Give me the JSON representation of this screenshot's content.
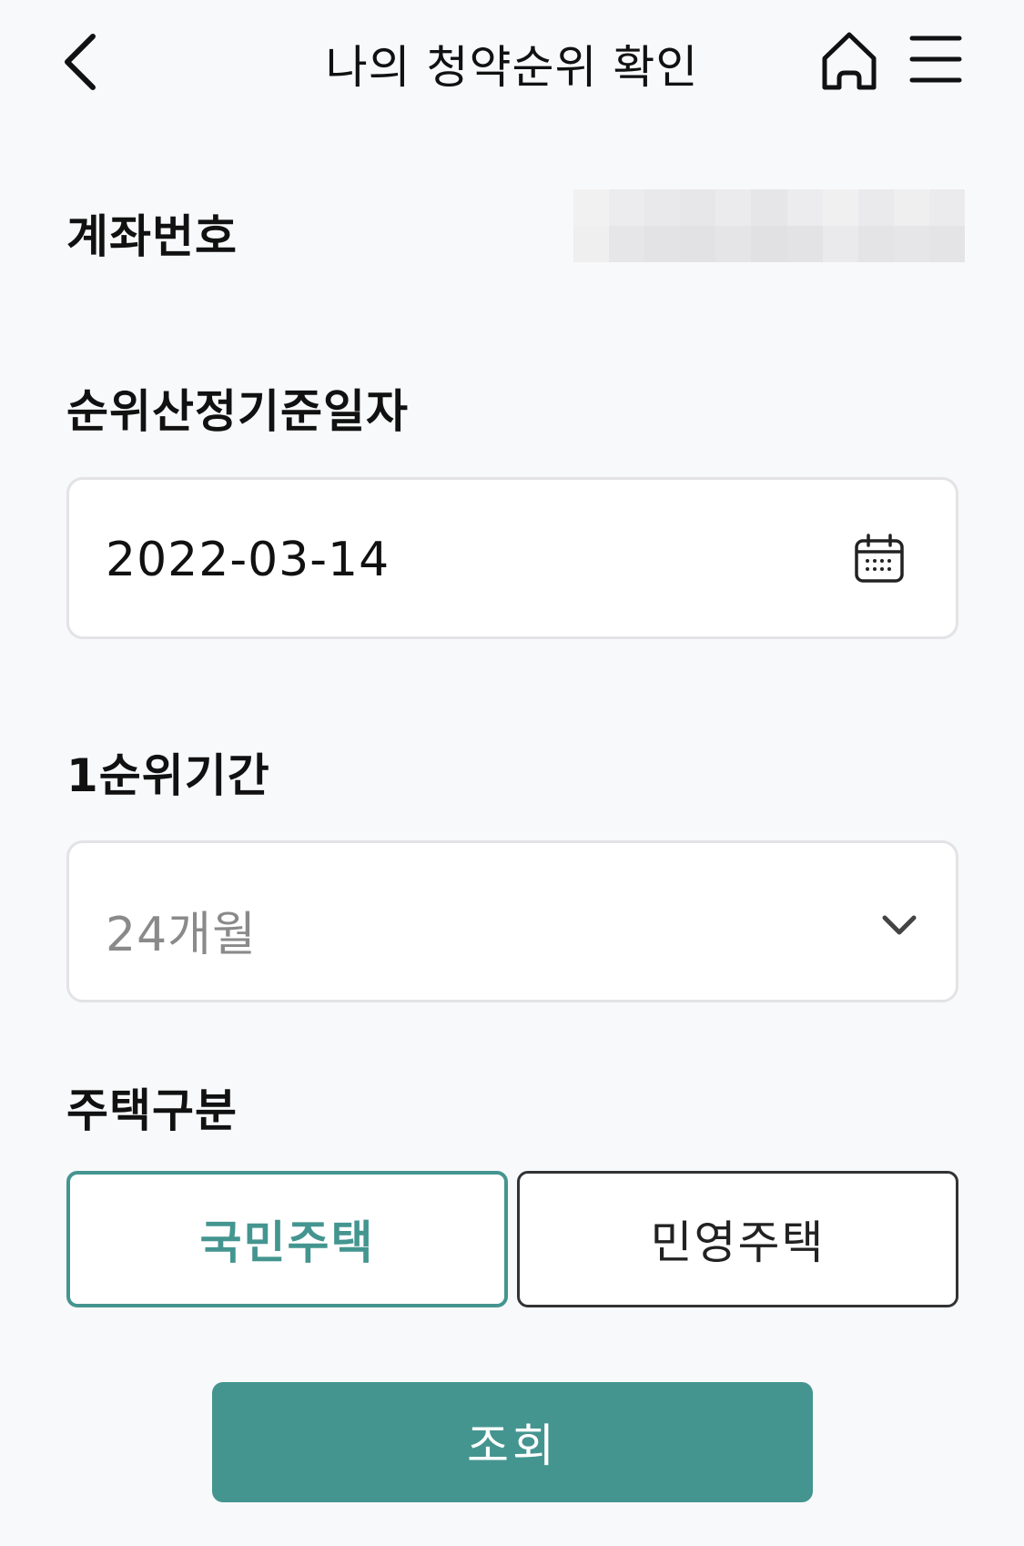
{
  "header": {
    "title": "나의 청약순위 확인",
    "back_icon": "chevron-left-icon",
    "home_icon": "home-icon",
    "menu_icon": "hamburger-menu-icon"
  },
  "account": {
    "label": "계좌번호"
  },
  "base_date": {
    "label": "순위산정기준일자",
    "value": "2022-03-14",
    "icon": "calendar-icon"
  },
  "first_rank_period": {
    "label": "1순위기간",
    "value": "24개월",
    "icon": "chevron-down-icon"
  },
  "housing_type": {
    "label": "주택구분",
    "options": [
      {
        "label": "국민주택",
        "selected": true
      },
      {
        "label": "민영주택",
        "selected": false
      }
    ]
  },
  "submit": {
    "label": "조회"
  },
  "colors": {
    "accent": "#449590",
    "background": "#f8f9fa",
    "field_border": "#e3e3e6"
  }
}
